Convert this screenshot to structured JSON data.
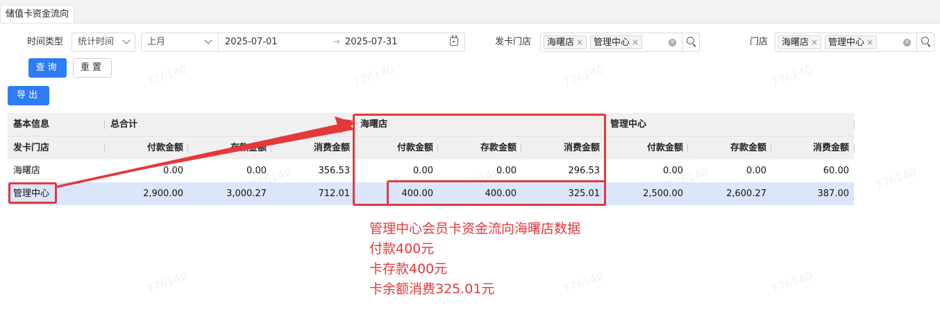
{
  "tab": {
    "label": "储值卡资金流向"
  },
  "filters": {
    "time_type_label": "时间类型",
    "time_type_value": "统计时间",
    "period_value": "上月",
    "date_start": "2025-07-01",
    "date_separator": "→",
    "date_end": "2025-07-31",
    "issuing_store_label": "发卡门店",
    "issuing_store_tags": [
      "海曙店",
      "管理中心"
    ],
    "store_label": "门店",
    "store_tags": [
      "海曙店",
      "管理中心"
    ]
  },
  "buttons": {
    "query": "查询",
    "reset": "重置",
    "export": "导出"
  },
  "table": {
    "group_headers": [
      "基本信息",
      "总合计",
      "海曙店",
      "管理中心"
    ],
    "column_headers": [
      "发卡门店",
      "付款金额",
      "存款金额",
      "消费金额",
      "付款金额",
      "存款金额",
      "消费金额",
      "付款金额",
      "存款金额",
      "消费金额"
    ],
    "rows": [
      {
        "store": "海曙店",
        "values": [
          "0.00",
          "0.00",
          "356.53",
          "0.00",
          "0.00",
          "296.53",
          "0.00",
          "0.00",
          "60.00"
        ]
      },
      {
        "store": "管理中心",
        "values": [
          "2,900.00",
          "3,000.27",
          "712.01",
          "400.00",
          "400.00",
          "325.01",
          "2,500.00",
          "2,600.27",
          "387.00"
        ]
      }
    ]
  },
  "watermark": "776140",
  "annotation": {
    "color": "#e5383b",
    "lines": [
      "管理中心会员卡资金流向海曙店数据",
      "付款400元",
      "卡存款400元",
      "卡余额消费325.01元"
    ]
  }
}
